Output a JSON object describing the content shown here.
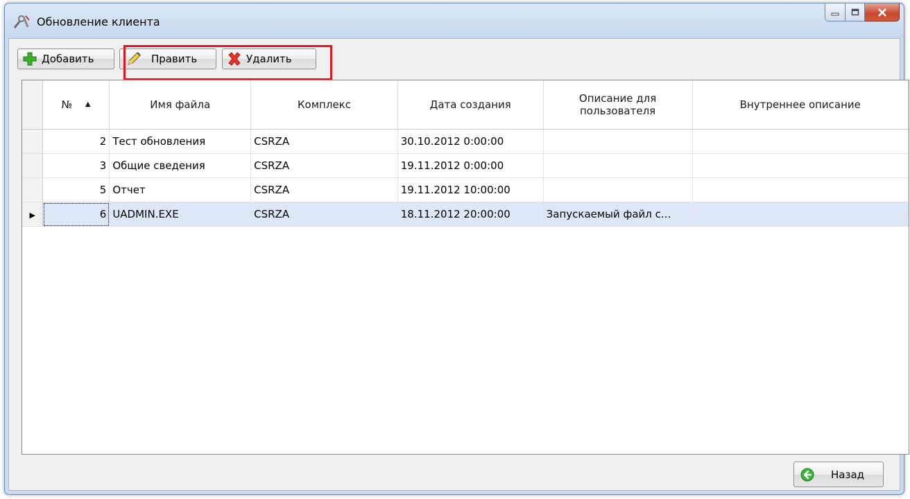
{
  "window": {
    "title": "Обновление клиента"
  },
  "toolbar": {
    "add_label": "Добавить",
    "edit_label": "Править",
    "delete_label": "Удалить"
  },
  "grid": {
    "columns": [
      "№",
      "Имя файла",
      "Комплекс",
      "Дата создания",
      "Описание для пользователя",
      "Внутреннее описание"
    ],
    "sort_column": "№",
    "sort_direction": "ascending",
    "rows": [
      {
        "num": "2",
        "file": "Тест обновления",
        "complex": "CSRZA",
        "date": "30.10.2012 0:00:00",
        "user_desc": "",
        "internal_desc": ""
      },
      {
        "num": "3",
        "file": "Общие сведения",
        "complex": "CSRZA",
        "date": "19.11.2012 0:00:00",
        "user_desc": "",
        "internal_desc": ""
      },
      {
        "num": "5",
        "file": "Отчет",
        "complex": "CSRZA",
        "date": "19.11.2012 10:00:00",
        "user_desc": "",
        "internal_desc": ""
      },
      {
        "num": "6",
        "file": "UADMIN.EXE",
        "complex": "CSRZA",
        "date": "18.11.2012 20:00:00",
        "user_desc": "Запускаемый файл с...",
        "internal_desc": ""
      }
    ],
    "selected_row": 3
  },
  "footer": {
    "back_label": "Назад"
  },
  "colors": {
    "highlight_border": "#e3151a",
    "selected_row": "#dde7f8",
    "window_frame": "#c9dbef"
  },
  "icons": [
    "window-tools-icon",
    "add-icon",
    "pencil-icon",
    "delete-x-icon",
    "back-arrow-icon",
    "minimize-icon",
    "maximize-icon",
    "close-icon"
  ]
}
